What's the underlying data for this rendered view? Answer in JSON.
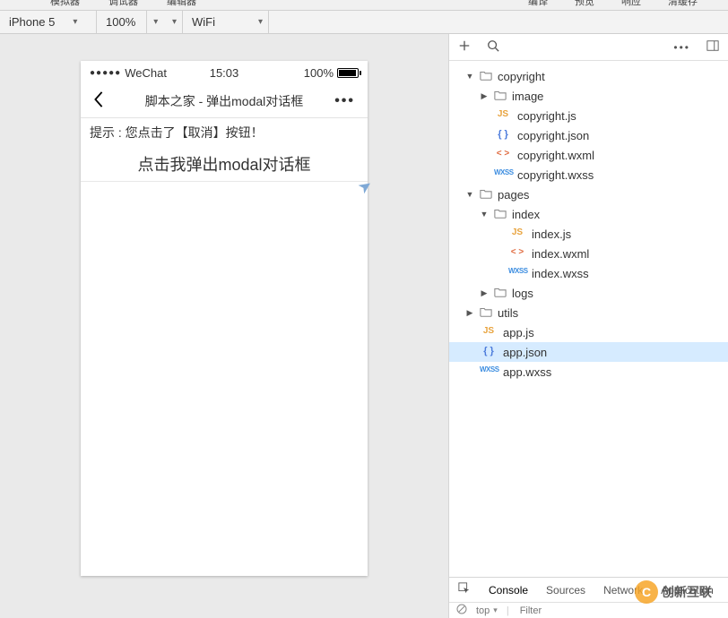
{
  "tabs": {
    "left": [
      "模拟器",
      "调试器",
      "编辑器"
    ],
    "right": [
      "编译",
      "预览",
      "响应",
      "清缓存"
    ]
  },
  "devbar": {
    "device": "iPhone 5",
    "zoom": "100%",
    "network": "WiFi"
  },
  "statusbar": {
    "carrier": "WeChat",
    "time": "15:03",
    "battery_pct": "100%"
  },
  "nav": {
    "title": "脚本之家 - 弹出modal对话框"
  },
  "page": {
    "tip": "提示 : 您点击了【取消】按钮！",
    "button": "点击我弹出modal对话框"
  },
  "tree": [
    {
      "type": "folder",
      "name": "copyright",
      "depth": 1,
      "open": true
    },
    {
      "type": "folder",
      "name": "image",
      "depth": 2,
      "open": false
    },
    {
      "type": "js",
      "name": "copyright.js",
      "depth": 2
    },
    {
      "type": "json",
      "name": "copyright.json",
      "depth": 2
    },
    {
      "type": "wxml",
      "name": "copyright.wxml",
      "depth": 2
    },
    {
      "type": "wxss",
      "name": "copyright.wxss",
      "depth": 2
    },
    {
      "type": "folder",
      "name": "pages",
      "depth": 1,
      "open": true
    },
    {
      "type": "folder",
      "name": "index",
      "depth": 2,
      "open": true
    },
    {
      "type": "js",
      "name": "index.js",
      "depth": 3
    },
    {
      "type": "wxml",
      "name": "index.wxml",
      "depth": 3
    },
    {
      "type": "wxss",
      "name": "index.wxss",
      "depth": 3
    },
    {
      "type": "folder",
      "name": "logs",
      "depth": 2,
      "open": false
    },
    {
      "type": "folder",
      "name": "utils",
      "depth": 1,
      "open": false
    },
    {
      "type": "js",
      "name": "app.js",
      "depth": 1
    },
    {
      "type": "json",
      "name": "app.json",
      "depth": 1,
      "selected": true
    },
    {
      "type": "wxss",
      "name": "app.wxss",
      "depth": 1
    }
  ],
  "bottom_tabs": [
    "Console",
    "Sources",
    "Network",
    "Application"
  ],
  "bottom_bar": {
    "context": "top",
    "filter_placeholder": "Filter"
  },
  "watermark": "创新互联"
}
